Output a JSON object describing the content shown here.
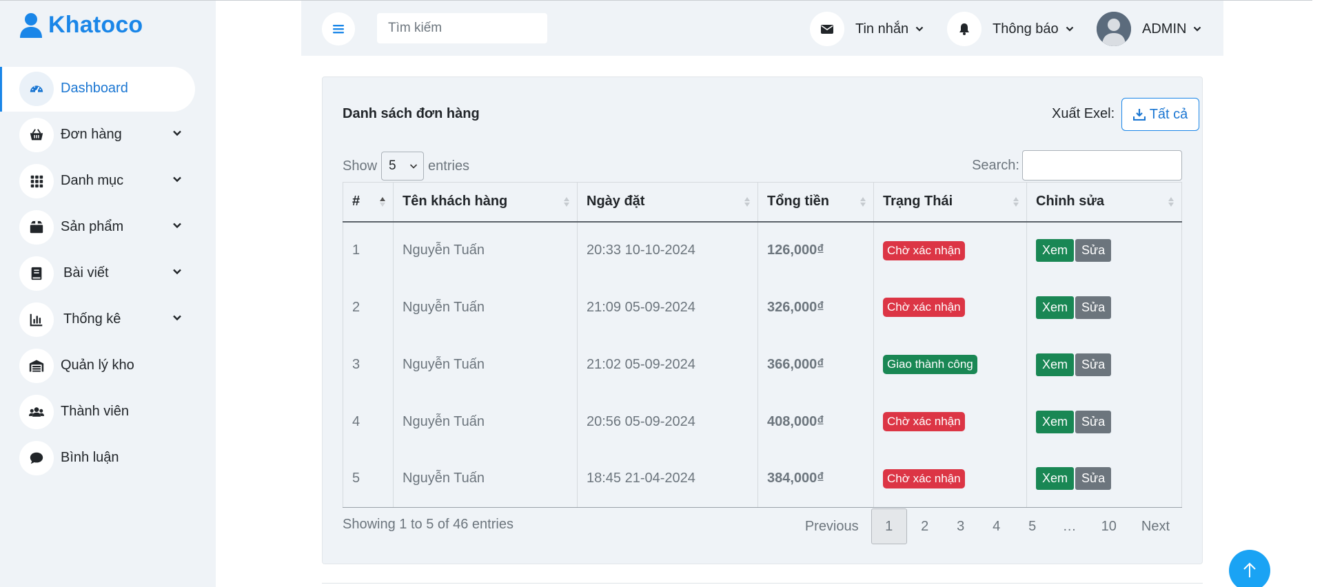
{
  "brand": {
    "name": "Khatoco",
    "icon": "user-icon"
  },
  "sidebar": {
    "items": [
      {
        "label": "Dashboard",
        "icon": "gauge-icon",
        "active": true,
        "has_children": false
      },
      {
        "label": "Đơn hàng",
        "icon": "basket-icon",
        "active": false,
        "has_children": true
      },
      {
        "label": "Danh mục",
        "icon": "grid-icon",
        "active": false,
        "has_children": true
      },
      {
        "label": "Sản phẩm",
        "icon": "box-icon",
        "active": false,
        "has_children": true
      },
      {
        "label": "Bài viết",
        "icon": "book-icon",
        "active": false,
        "has_children": true
      },
      {
        "label": "Thống kê",
        "icon": "chart-icon",
        "active": false,
        "has_children": true
      },
      {
        "label": "Quản lý kho",
        "icon": "warehouse-icon",
        "active": false,
        "has_children": false
      },
      {
        "label": "Thành viên",
        "icon": "users-icon",
        "active": false,
        "has_children": false
      },
      {
        "label": "Bình luận",
        "icon": "comment-icon",
        "active": false,
        "has_children": false
      }
    ]
  },
  "topbar": {
    "search_placeholder": "Tìm kiếm",
    "messages_label": "Tin nhắn",
    "notifications_label": "Thông báo",
    "user_label": "ADMIN"
  },
  "orders_card": {
    "title": "Danh sách đơn hàng",
    "export_label": "Xuất Exel:",
    "export_button": "Tất cả",
    "show_label": "Show",
    "entries_label": "entries",
    "page_length": "5",
    "search_label": "Search:",
    "columns": [
      "#",
      "Tên khách hàng",
      "Ngày đặt",
      "Tổng tiền",
      "Trạng Thái",
      "Chỉnh sửa"
    ],
    "rows": [
      {
        "no": "1",
        "customer": "Nguyễn Tuấn",
        "date": "20:33 10-10-2024",
        "total": "126,000₫",
        "status": "Chờ xác nhận",
        "status_type": "pending"
      },
      {
        "no": "2",
        "customer": "Nguyễn Tuấn",
        "date": "21:09 05-09-2024",
        "total": "326,000₫",
        "status": "Chờ xác nhận",
        "status_type": "pending"
      },
      {
        "no": "3",
        "customer": "Nguyễn Tuấn",
        "date": "21:02 05-09-2024",
        "total": "366,000₫",
        "status": "Giao thành công",
        "status_type": "done"
      },
      {
        "no": "4",
        "customer": "Nguyễn Tuấn",
        "date": "20:56 05-09-2024",
        "total": "408,000₫",
        "status": "Chờ xác nhận",
        "status_type": "pending"
      },
      {
        "no": "5",
        "customer": "Nguyễn Tuấn",
        "date": "18:45 21-04-2024",
        "total": "384,000₫",
        "status": "Chờ xác nhận",
        "status_type": "pending"
      }
    ],
    "view_label": "Xem",
    "edit_label": "Sửa",
    "info": "Showing 1 to 5 of 46 entries",
    "pagination": {
      "previous": "Previous",
      "pages": [
        "1",
        "2",
        "3",
        "4",
        "5",
        "…",
        "10"
      ],
      "current": "1",
      "next": "Next"
    }
  },
  "colors": {
    "primary": "#1a86e8",
    "sidebar_bg": "#eff3f7",
    "badge_pending": "#dc3545",
    "badge_done": "#198754",
    "btn_view": "#198754",
    "btn_edit": "#6c757d",
    "scroll_top": "#1aa3f4"
  }
}
